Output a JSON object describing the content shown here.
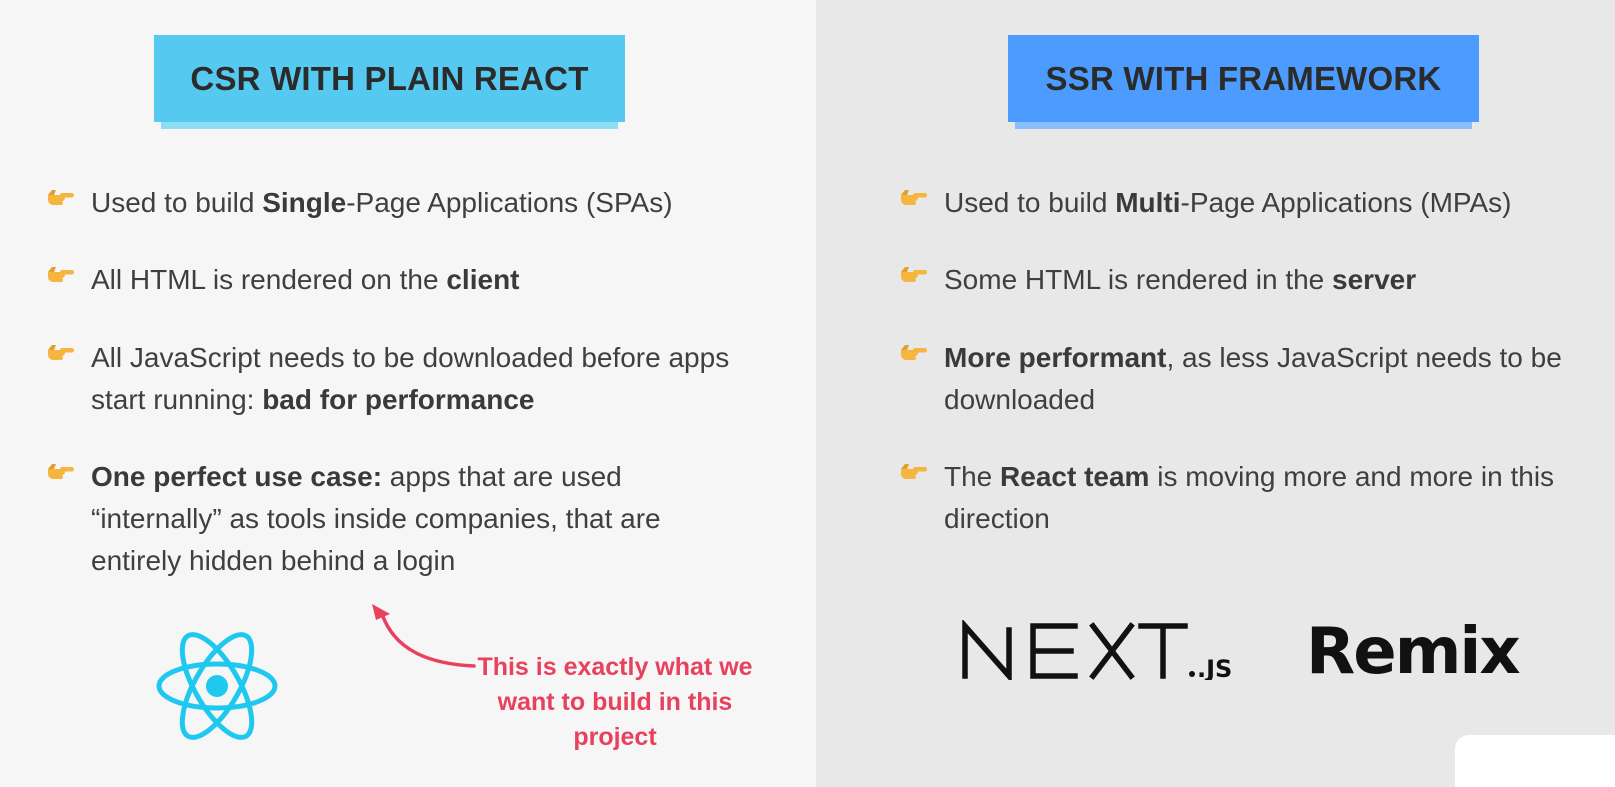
{
  "left": {
    "heading": "CSR WITH PLAIN REACT",
    "bullets": [
      {
        "a": "Used to build ",
        "b": "Single",
        "c": "-Page Applications (SPAs)"
      },
      {
        "a": "All HTML is rendered on the ",
        "b": "client",
        "c": ""
      },
      {
        "a": "All JavaScript needs to be downloaded before apps start running: ",
        "b": "bad for performance",
        "c": ""
      },
      {
        "a": "",
        "b": "One perfect use case:",
        "c": " apps that are used “internally” as tools inside companies, that are entirely hidden behind a login"
      }
    ],
    "annotation": "This is exactly what we want to build in this project",
    "logo_icon": "react-logo-icon"
  },
  "right": {
    "heading": "SSR WITH FRAMEWORK",
    "bullets": [
      {
        "a": "Used to build ",
        "b": "Multi",
        "c": "-Page Applications (MPAs)"
      },
      {
        "a": "Some HTML is rendered in the ",
        "b": "server",
        "c": ""
      },
      {
        "a": "",
        "b": "More performant",
        "c": ", as less JavaScript needs to be downloaded"
      },
      {
        "a": "The ",
        "b": "React team",
        "c": " is moving more and more in this direction"
      }
    ],
    "next_logo": {
      "main": "NEXT",
      "suffix": ".JS"
    },
    "remix_logo": "Remix"
  },
  "colors": {
    "left_heading_bg": "#55c9ef",
    "right_heading_bg": "#4c9cff",
    "annotation": "#e8415e",
    "react_logo": "#1ec8ee"
  }
}
